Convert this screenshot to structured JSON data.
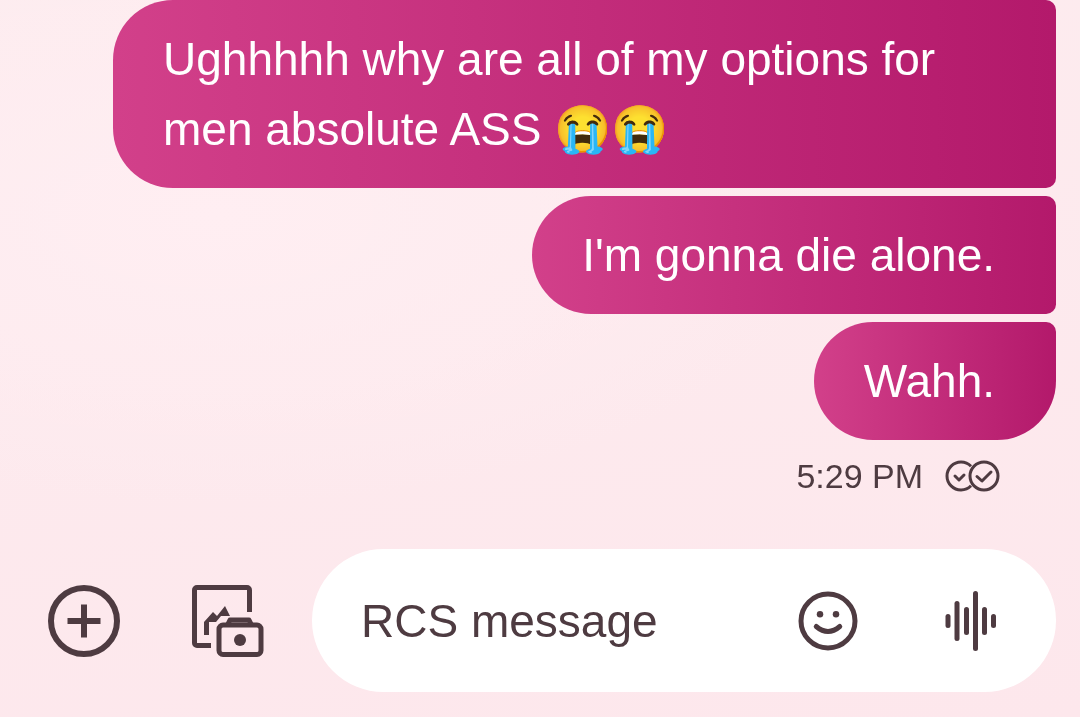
{
  "messages": [
    {
      "text": "Ughhhhh why are all of my options for men absolute ASS 😭😭"
    },
    {
      "text": "I'm gonna die alone."
    },
    {
      "text": "Wahh."
    }
  ],
  "status": {
    "time": "5:29 PM",
    "delivered": true
  },
  "composer": {
    "placeholder": "RCS message"
  }
}
